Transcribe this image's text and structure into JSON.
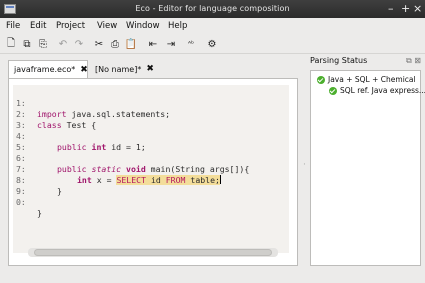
{
  "window": {
    "title": "Eco - Editor for language composition",
    "controls": [
      "–",
      "+",
      "×"
    ]
  },
  "menu": [
    "File",
    "Edit",
    "Project",
    "View",
    "Window",
    "Help"
  ],
  "toolbar_icons": [
    "new-file-icon",
    "open-icon",
    "save-all-icon",
    "undo-icon",
    "redo-icon",
    "cut-icon",
    "copy-icon",
    "paste-icon",
    "move-left-icon",
    "move-right-icon",
    "select-font-icon",
    "settings-icon"
  ],
  "toolbar_glyphs": [
    "🗋",
    "⧉",
    "⎘",
    "↶",
    "↷",
    "✂",
    "⎙",
    "📋",
    "⇤",
    "⇥",
    "ᴬᵇ",
    "⚙"
  ],
  "tabs": [
    {
      "label": "javaframe.eco*",
      "close": "✖",
      "active": true
    },
    {
      "label": "[No name]*",
      "close": "✖",
      "active": false
    }
  ],
  "editor": {
    "line_numbers": [
      "1:",
      "2:",
      "3:",
      "4:",
      "5:",
      "6:",
      "7:",
      "8:",
      "9:",
      "0:"
    ],
    "lines": {
      "l1_kw": "import",
      "l1_rest": " java.sql.statements;",
      "l2_kw": "class",
      "l2_rest": " Test {",
      "l4_kw1": "public",
      "l4_kw2": "int",
      "l4_rest": " id = 1;",
      "l6_kw1": "public",
      "l6_kw2": "static",
      "l6_kw3": "void",
      "l6_rest": " main(String args[]){",
      "l7_kw": "int",
      "l7_rest": " x = ",
      "l7_sql1": "SELECT",
      "l7_sql2": " id ",
      "l7_sql3": "FROM",
      "l7_sql4": " table;",
      "l8": "}",
      "l0": "}"
    }
  },
  "parsing_status": {
    "title": "Parsing Status",
    "panel_icons": "⧉ ⊠",
    "items": [
      {
        "label": "Java + SQL + Chemical",
        "status": "ok"
      },
      {
        "label": "SQL ref. Java express...",
        "status": "ok"
      }
    ]
  },
  "colors": {
    "keyword": "#a0156b",
    "sql_highlight": "#f3dd9a",
    "ok": "#4caf2e"
  }
}
